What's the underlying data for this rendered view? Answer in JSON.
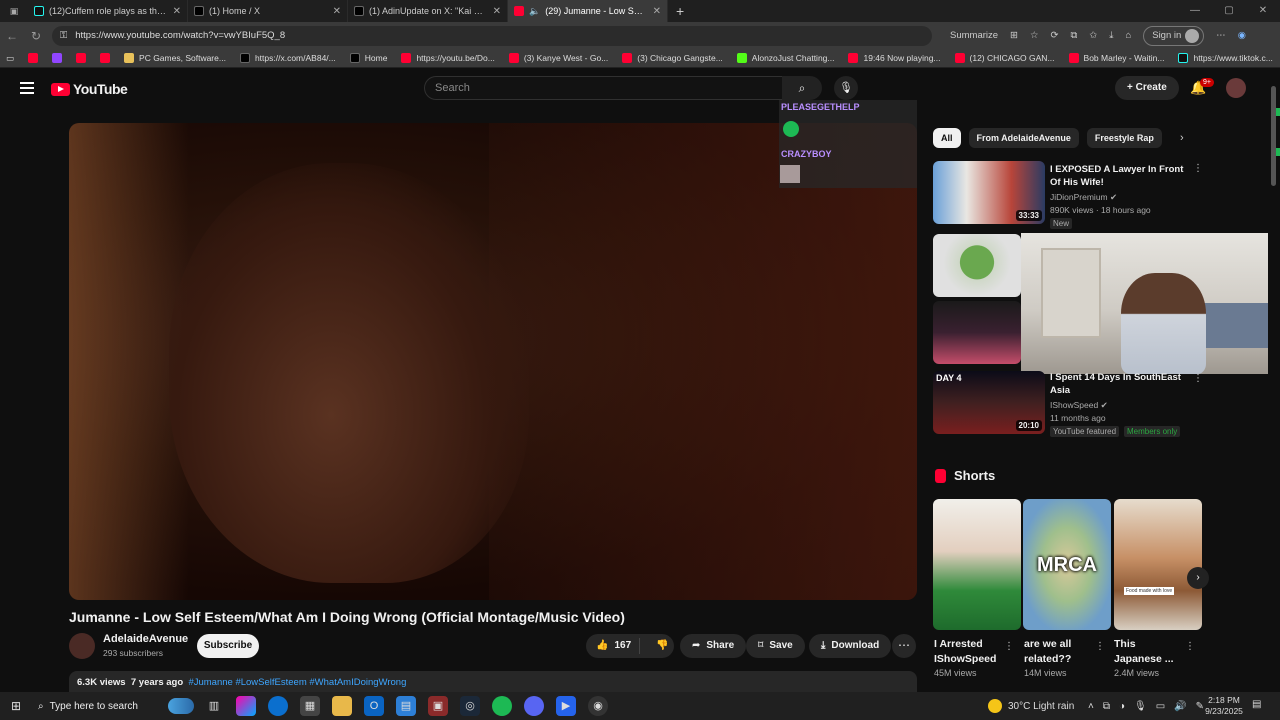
{
  "browser": {
    "tabs": [
      {
        "title": "(12)Cuffem role plays as the ave",
        "icon": "tiktok-icon",
        "active": false
      },
      {
        "title": "(1) Home / X",
        "icon": "x-icon",
        "active": false
      },
      {
        "title": "(1) AdinUpdate on X: \"Kai Cenat",
        "icon": "x-icon",
        "active": false
      },
      {
        "title": "(29) Jumanne - Low Self Este",
        "icon": "youtube-icon",
        "active": true
      }
    ],
    "url": "https://www.youtube.com/watch?v=vwYBIuF5Q_8",
    "summarize_label": "Summarize",
    "signin_label": "Sign in",
    "bookmarks": [
      {
        "label": "",
        "icon": "youtube-icon"
      },
      {
        "label": "",
        "icon": "twitch-icon"
      },
      {
        "label": "",
        "icon": "youtube-icon"
      },
      {
        "label": "",
        "icon": "youtube-icon"
      },
      {
        "label": "PC Games, Software...",
        "icon": "folder-icon"
      },
      {
        "label": "https://x.com/AB84/...",
        "icon": "x-icon"
      },
      {
        "label": "Home",
        "icon": "x-icon"
      },
      {
        "label": "https://youtu.be/Do...",
        "icon": "youtube-icon"
      },
      {
        "label": "(3) Kanye West - Go...",
        "icon": "youtube-icon"
      },
      {
        "label": "(3) Chicago Gangste...",
        "icon": "youtube-icon"
      },
      {
        "label": "AlonzoJust Chatting...",
        "icon": "kick-icon"
      },
      {
        "label": "19:46 Now playing...",
        "icon": "youtube-icon"
      },
      {
        "label": "(12) CHICAGO GAN...",
        "icon": "youtube-icon"
      },
      {
        "label": "Bob Marley - Waitin...",
        "icon": "youtube-icon"
      },
      {
        "label": "https://www.tiktok.c...",
        "icon": "tiktok-icon"
      }
    ]
  },
  "youtube": {
    "logo_text": "YouTube",
    "search_placeholder": "Search",
    "create_label": "Create",
    "notif_badge": "9+",
    "video": {
      "title": "Jumanne - Low Self Esteem/What Am I Doing Wrong (Official Montage/Music Video)",
      "channel": "AdelaideAvenue",
      "subscribers": "293 subscribers",
      "subscribe_label": "Subscribe",
      "likes": "167",
      "share_label": "Share",
      "save_label": "Save",
      "download_label": "Download",
      "views": "6.3K views",
      "age": "7 years ago",
      "hashtags": "#Jumanne #LowSelfEsteem #WhatAmIDoingWrong"
    },
    "chat_overlay": {
      "user1": "PLEASEGETHELP",
      "user2": "CRAZYBOY"
    },
    "chips": [
      "All",
      "From AdelaideAvenue",
      "Freestyle Rap"
    ],
    "recommendations": [
      {
        "title": "I EXPOSED A Lawyer In Front Of His Wife!",
        "channel": "JiDionPremium",
        "meta": "890K views · 18 hours ago",
        "duration": "33:33",
        "tag": "New"
      },
      {
        "title": "I Spent 14 Days In SouthEast Asia",
        "channel": "IShowSpeed",
        "meta": "11 months ago",
        "duration": "20:10",
        "tag": "YouTube featured",
        "tag2": "Members only",
        "thumb_text": "DAY 4"
      }
    ],
    "shorts_label": "Shorts",
    "shorts": [
      {
        "title": "I Arrested IShowSpeed",
        "views": "45M views"
      },
      {
        "title": "are we all related??",
        "views": "14M views",
        "thumb_text": "MRCA"
      },
      {
        "title": "This Japanese ...",
        "views": "2.4M views",
        "thumb_text": "Food made with love"
      }
    ]
  },
  "taskbar": {
    "search_placeholder": "Type here to search",
    "weather": "30°C  Light rain",
    "time": "2:18 PM",
    "date": "9/23/2025"
  }
}
